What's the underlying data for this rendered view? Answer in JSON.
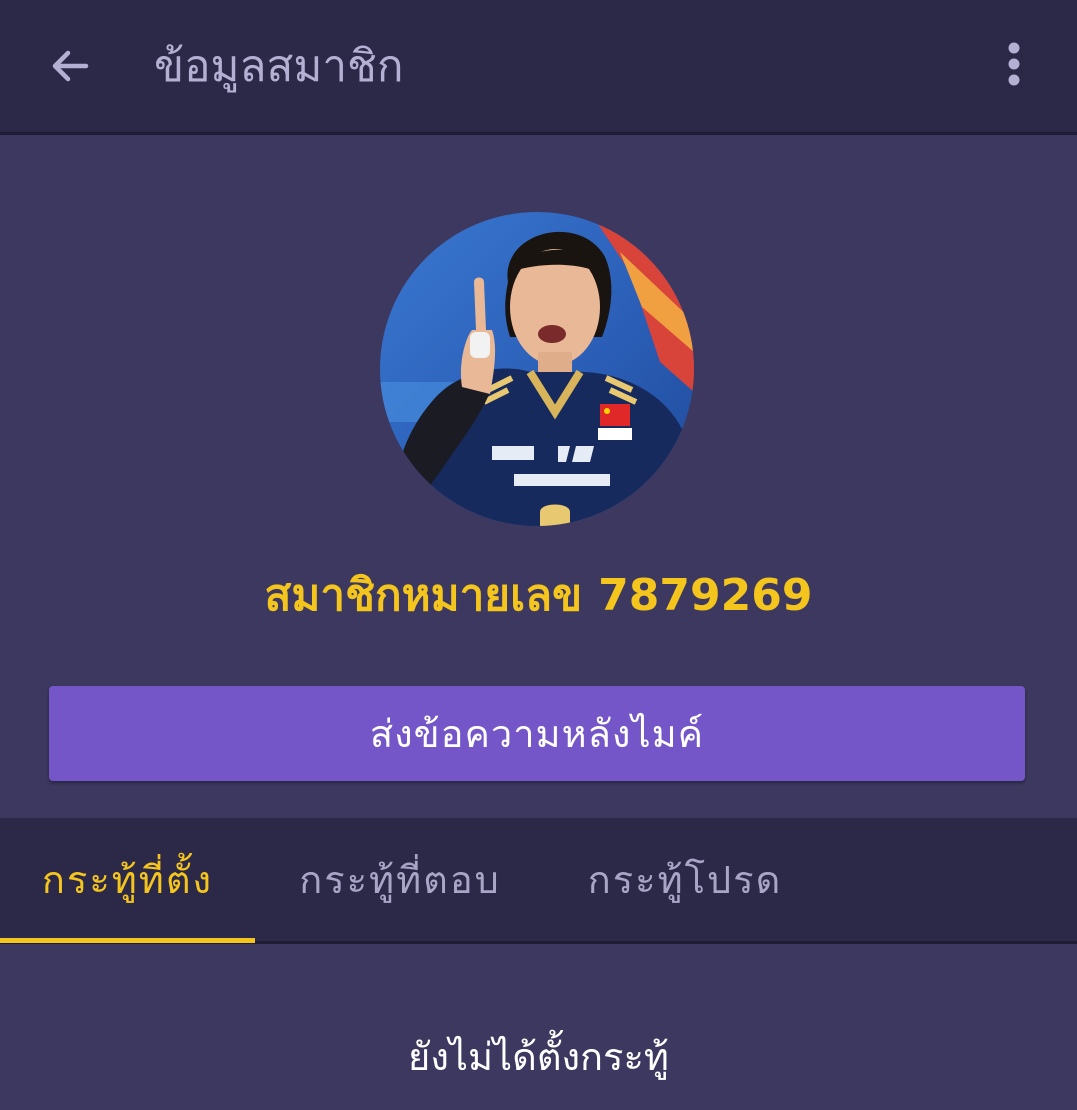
{
  "appbar": {
    "title": "ข้อมูลสมาชิก",
    "back_icon": "arrow-left-icon",
    "menu_icon": "more-vert-icon"
  },
  "profile": {
    "avatar_icon": "profile-photo",
    "member_label": "สมาชิกหมายเลข",
    "member_number": "7879269"
  },
  "actions": {
    "send_message_label": "ส่งข้อความหลังไมค์"
  },
  "tabs": [
    {
      "label": "กระทู้ที่ตั้ง",
      "active": true
    },
    {
      "label": "กระทู้ที่ตอบ",
      "active": false
    },
    {
      "label": "กระทู้โปรด",
      "active": false
    }
  ],
  "content": {
    "empty_message": "ยังไม่ได้ตั้งกระทู้"
  },
  "colors": {
    "background": "#3c385f",
    "appbar": "#2c2848",
    "accent_yellow": "#f3c51d",
    "button_purple": "#7456c8",
    "inactive_text": "#a8a5c6"
  }
}
